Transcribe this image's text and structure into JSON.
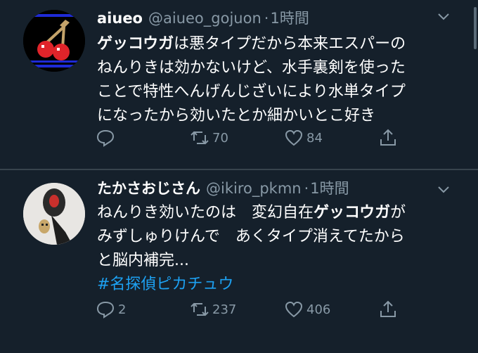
{
  "tweets": [
    {
      "name": "aiueo",
      "handle": "@aiueo_gojuon",
      "dot": "·",
      "time": "1時間",
      "body_lines": [
        {
          "bold": "ゲッコウガ",
          "rest": "は悪タイプだから本来エスパーの"
        },
        {
          "text": "ねんりきは効かないけど、水手裏剣を使った"
        },
        {
          "text": "ことで特性へんげんじざいにより水単タイプ"
        },
        {
          "text": "になったから効いたとか細かいとこ好き"
        }
      ],
      "reply_count": "",
      "retweet_count": "70",
      "like_count": "84"
    },
    {
      "name": "たかさおじさん",
      "handle": "@ikiro_pkmn",
      "dot": "·",
      "time": "1時間",
      "body_line1_pre": "ねんりき効いたのは　変幻自在",
      "body_line1_bold": "ゲッコウガ",
      "body_line1_post": "が",
      "body_line2": "みずしゅりけんで　あくタイプ消えてたから",
      "body_line3": "と脳内補完...",
      "hashtag": "#名探偵ピカチュウ",
      "reply_count": "2",
      "retweet_count": "237",
      "like_count": "406"
    }
  ],
  "colors": {
    "background": "#15202b",
    "text": "#ffffff",
    "secondary": "#8899a6",
    "link": "#1da1f2",
    "divider": "#38444d"
  },
  "icons": [
    "reply-icon",
    "retweet-icon",
    "like-icon",
    "share-icon",
    "chevron-down-icon"
  ]
}
